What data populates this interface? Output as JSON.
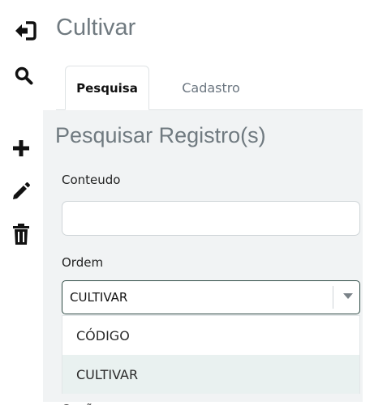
{
  "header": {
    "title": "Cultivar"
  },
  "sidebar": {
    "icons": [
      {
        "name": "exit-icon"
      },
      {
        "name": "search-icon"
      },
      {
        "name": "plus-icon"
      },
      {
        "name": "pencil-icon"
      },
      {
        "name": "trash-icon"
      }
    ]
  },
  "tabs": [
    {
      "label": "Pesquisa",
      "active": true
    },
    {
      "label": "Cadastro",
      "active": false
    }
  ],
  "search_panel": {
    "title": "Pesquisar Registro(s)",
    "content_label": "Conteudo",
    "content_value": "",
    "order_label": "Ordem",
    "order_value": "CULTIVAR",
    "order_options": [
      "CÓDIGO",
      "CULTIVAR"
    ],
    "next_label": "Opção"
  },
  "colors": {
    "accent_border": "#2f4b45",
    "muted_text": "#707a80",
    "panel_bg": "#f1f3f4"
  }
}
